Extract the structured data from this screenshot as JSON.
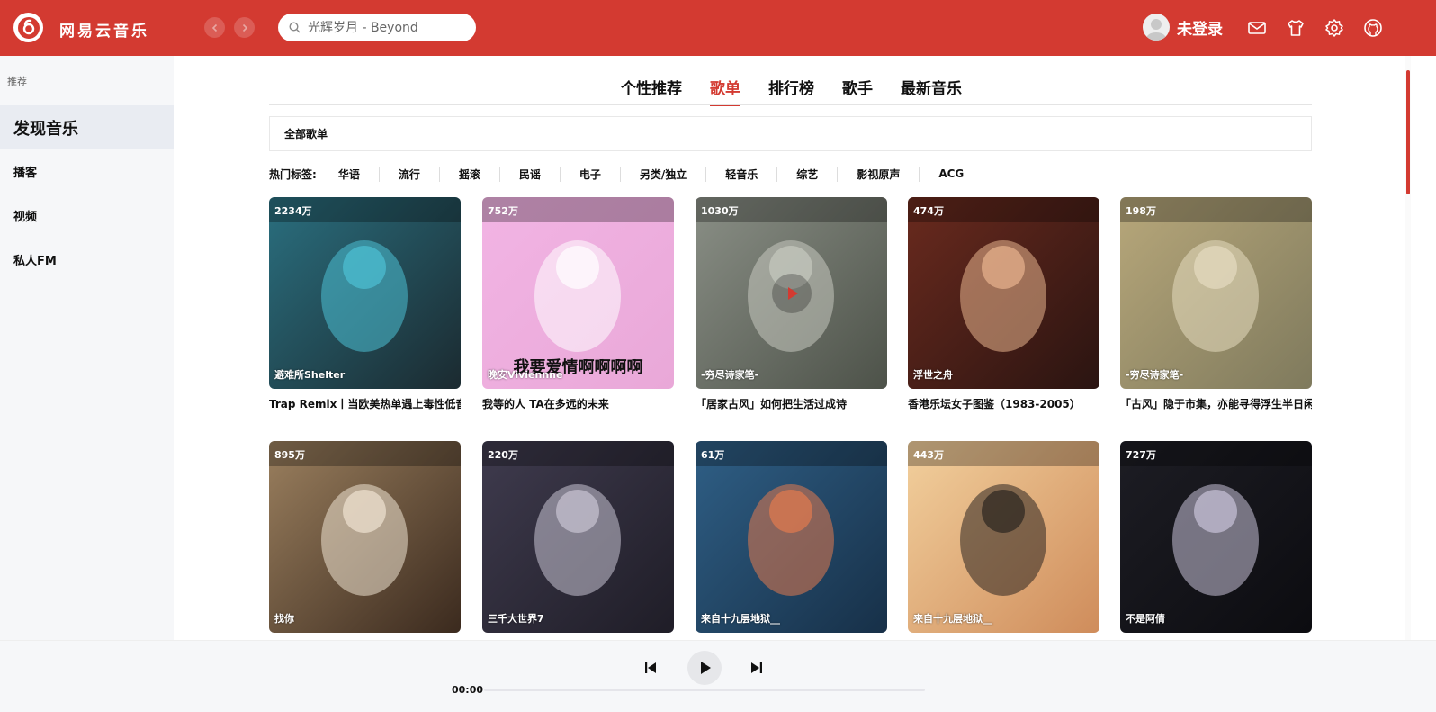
{
  "app": {
    "name": "网易云音乐"
  },
  "header": {
    "search_placeholder": "光辉岁月 - Beyond",
    "user_name": "未登录",
    "icons": [
      "mail-icon",
      "shirt-icon",
      "gear-icon",
      "github-icon"
    ]
  },
  "sidebar": {
    "section": "推荐",
    "items": [
      {
        "label": "发现音乐"
      },
      {
        "label": "播客"
      },
      {
        "label": "视频"
      },
      {
        "label": "私人FM"
      }
    ]
  },
  "tabs": [
    {
      "label": "个性推荐"
    },
    {
      "label": "歌单"
    },
    {
      "label": "排行榜"
    },
    {
      "label": "歌手"
    },
    {
      "label": "最新音乐"
    }
  ],
  "filter": {
    "all_label": "全部歌单",
    "hot_label": "热门标签:",
    "tags": [
      "华语",
      "流行",
      "摇滚",
      "民谣",
      "电子",
      "另类/独立",
      "轻音乐",
      "综艺",
      "影视原声",
      "ACG"
    ]
  },
  "playlists": [
    {
      "count": "2234万",
      "author": "避难所Shelter",
      "title": "Trap Remix丨当欧美热单遇上毒性低音",
      "colors": [
        "#2a6f7f",
        "#1b2a30",
        "#4dc0d4"
      ]
    },
    {
      "count": "752万",
      "author": "晚安Viviennne",
      "title": "我等的人 TA在多远的未来",
      "colors": [
        "#f2b4e4",
        "#e9a8d8",
        "#ffffff"
      ],
      "overlay_text": "我要爱情啊啊啊啊"
    },
    {
      "count": "1030万",
      "author": "-穷尽诗家笔-",
      "title": "「居家古风」如何把生活过成诗",
      "colors": [
        "#8a8f86",
        "#4d5249",
        "#c6c9bf"
      ]
    },
    {
      "count": "474万",
      "author": "浮世之舟",
      "title": "香港乐坛女子图鉴（1983-2005）",
      "colors": [
        "#6a2a1e",
        "#2a1411",
        "#e8b48e"
      ]
    },
    {
      "count": "198万",
      "author": "-穷尽诗家笔-",
      "title": "「古风」隐于市集，亦能寻得浮生半日闲",
      "colors": [
        "#b7a77a",
        "#7f7a5d",
        "#e6dcc0"
      ]
    },
    {
      "count": "895万",
      "author": "找你",
      "title": "",
      "colors": [
        "#9a7f5e",
        "#3b2a1e",
        "#efe3d2"
      ]
    },
    {
      "count": "220万",
      "author": "三千大世界7",
      "title": "",
      "colors": [
        "#3f3b4e",
        "#1f1d27",
        "#c9c5d3"
      ]
    },
    {
      "count": "61万",
      "author": "来自十九层地狱__",
      "title": "",
      "colors": [
        "#2f5f86",
        "#173048",
        "#e27a4e"
      ]
    },
    {
      "count": "443万",
      "author": "来自十九层地狱__",
      "title": "",
      "colors": [
        "#f2d09d",
        "#cf8c5b",
        "#2b2520"
      ]
    },
    {
      "count": "727万",
      "author": "不是阿倩",
      "title": "",
      "colors": [
        "#1d1d24",
        "#0c0c10",
        "#c9c3d8"
      ]
    }
  ],
  "player": {
    "time": "00:00"
  }
}
